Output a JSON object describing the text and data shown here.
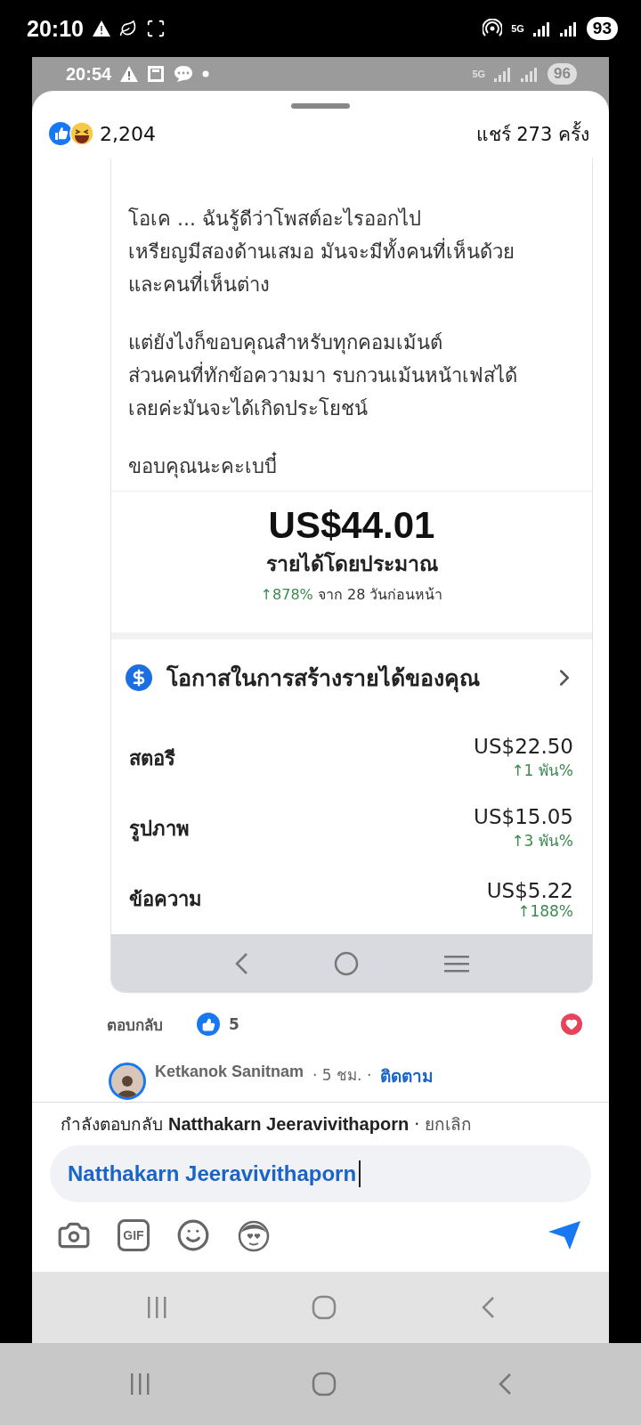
{
  "outer_status_bar": {
    "time": "20:10",
    "network": "5G",
    "battery": "93"
  },
  "inner_status_bar": {
    "time": "20:54",
    "network": "5G",
    "battery": "96"
  },
  "reactions": {
    "count": "2,204",
    "shares": "แชร์ 273 ครั้ง"
  },
  "comment_image": {
    "paragraphs": [
      "โอเค ... ฉันรู้ดีว่าโพสต์อะไรออกไป\nเหรียญมีสองด้านเสมอ มันจะมีทั้งคนที่เห็นด้วย\nและคนที่เห็นต่าง",
      "แต่ยังไงก็ขอบคุณสำหรับทุกคอมเม้นต์\nส่วนคนที่ทักข้อความมา รบกวนเม้นหน้าเฟสได้\nเลยค่ะมันจะได้เกิดประโยชน์",
      "ขอบคุณนะคะเบบี๋"
    ],
    "earnings": {
      "amount": "US$44.01",
      "label": "รายได้โดยประมาณ",
      "change": "↑878%",
      "change_note": "จาก 28 วันก่อนหน้า"
    },
    "section_title": "โอกาสในการสร้างรายได้ของคุณ",
    "rows": [
      {
        "label": "สตอรี",
        "amount": "US$22.50",
        "change": "↑1 พัน%"
      },
      {
        "label": "รูปภาพ",
        "amount": "US$15.05",
        "change": "↑3 พัน%"
      },
      {
        "label": "ข้อความ",
        "amount": "US$5.22",
        "change": "↑188%"
      }
    ]
  },
  "comment_actions": {
    "reply": "ตอบกลับ",
    "like_count": "5"
  },
  "next_comment": {
    "author": "Ketkanok Sanitnam",
    "time": "· 5 ชม. ·",
    "follow": "ติดตาม"
  },
  "composer": {
    "replying": "กำลังตอบกลับ **Natthakarn Jeeravivithaporn** ·",
    "cancel": "ยกเลิก",
    "value": "Natthakarn Jeeravivithaporn",
    "gif_label": "GIF"
  }
}
